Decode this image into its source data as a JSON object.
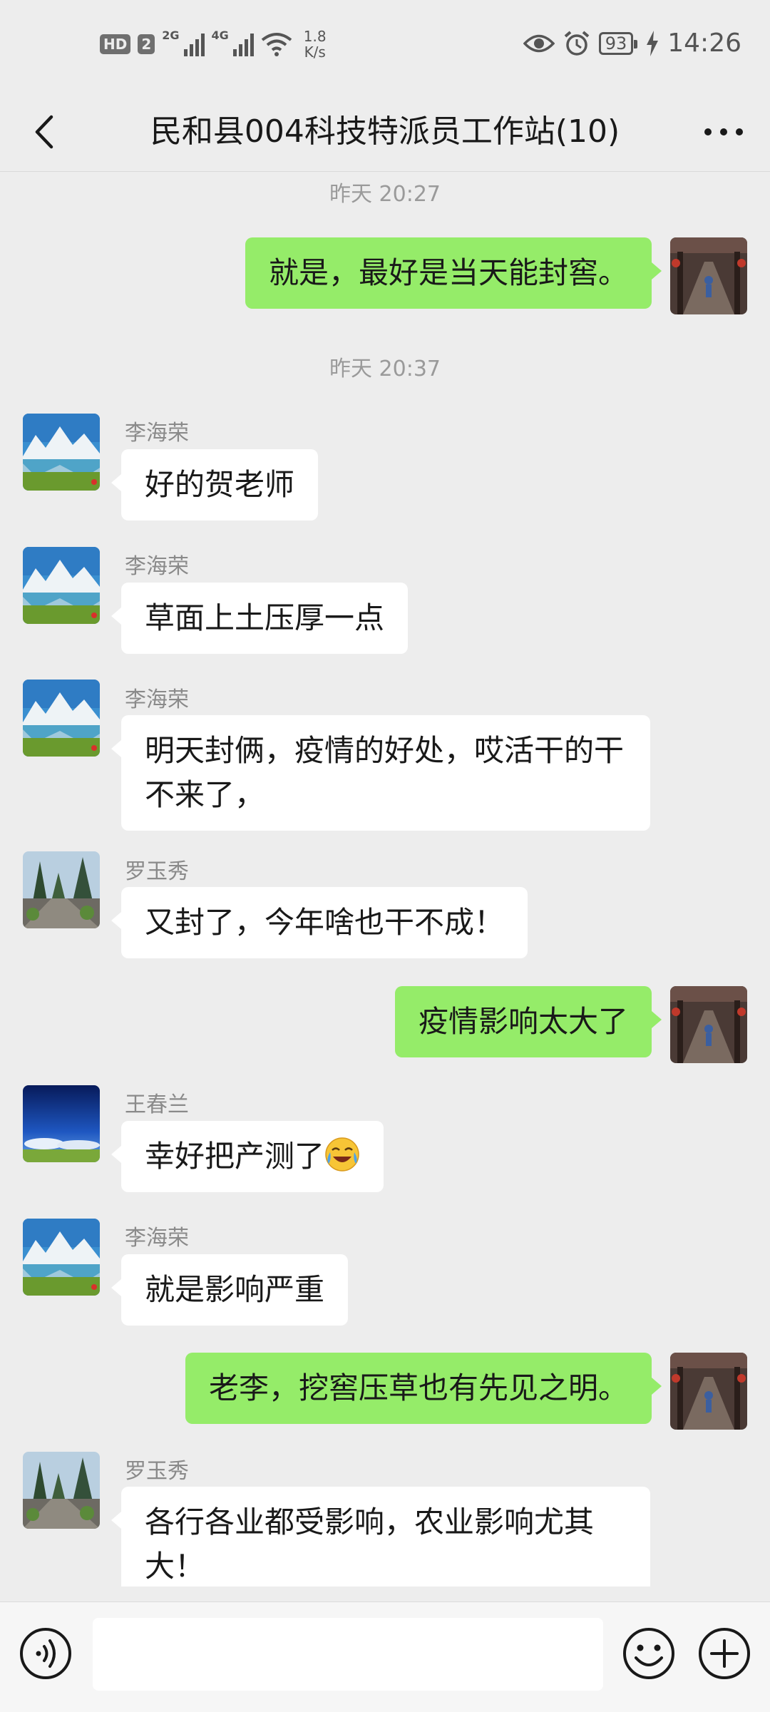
{
  "status_bar": {
    "hd_label": "HD",
    "sim_label": "2",
    "net1_label": "2G",
    "net2_label": "4G",
    "speed_value": "1.8",
    "speed_unit": "K/s",
    "battery": "93",
    "time": "14:26",
    "icons": [
      "eye-icon",
      "alarm-icon",
      "charging-icon"
    ]
  },
  "nav": {
    "title": "民和县004科技特派员工作站(10)",
    "back_icon": "chevron-left-icon",
    "more_icon": "more-dots-icon"
  },
  "chat": {
    "timestamps": [
      "昨天 20:27",
      "昨天 20:37"
    ],
    "messages": [
      {
        "direction": "out",
        "sender": "",
        "text": "就是，最好是当天能封窖。"
      },
      {
        "direction": "in",
        "sender": "李海荣",
        "text": "好的贺老师"
      },
      {
        "direction": "in",
        "sender": "李海荣",
        "text": "草面上土压厚一点"
      },
      {
        "direction": "in",
        "sender": "李海荣",
        "text": "明天封俩，疫情的好处，哎活干的干不来了，"
      },
      {
        "direction": "in",
        "sender": "罗玉秀",
        "text": "又封了，今年啥也干不成！"
      },
      {
        "direction": "out",
        "sender": "",
        "text": "疫情影响太大了"
      },
      {
        "direction": "in",
        "sender": "王春兰",
        "text": "幸好把产测了",
        "emoji": "laughing-crying-emoji"
      },
      {
        "direction": "in",
        "sender": "李海荣",
        "text": "就是影响严重"
      },
      {
        "direction": "out",
        "sender": "",
        "text": "老李，挖窖压草也有先见之明。"
      },
      {
        "direction": "in",
        "sender": "罗玉秀",
        "text": "各行各业都受影响，农业影响尤其大！"
      }
    ]
  },
  "input_bar": {
    "voice_icon": "voice-icon",
    "emoji_icon": "emoji-icon",
    "plus_icon": "plus-icon",
    "input_value": ""
  },
  "colors": {
    "background": "#ededed",
    "bubble_out": "#95ec69",
    "bubble_in": "#ffffff",
    "text": "#191919",
    "secondary_text": "#9a9a9a"
  }
}
